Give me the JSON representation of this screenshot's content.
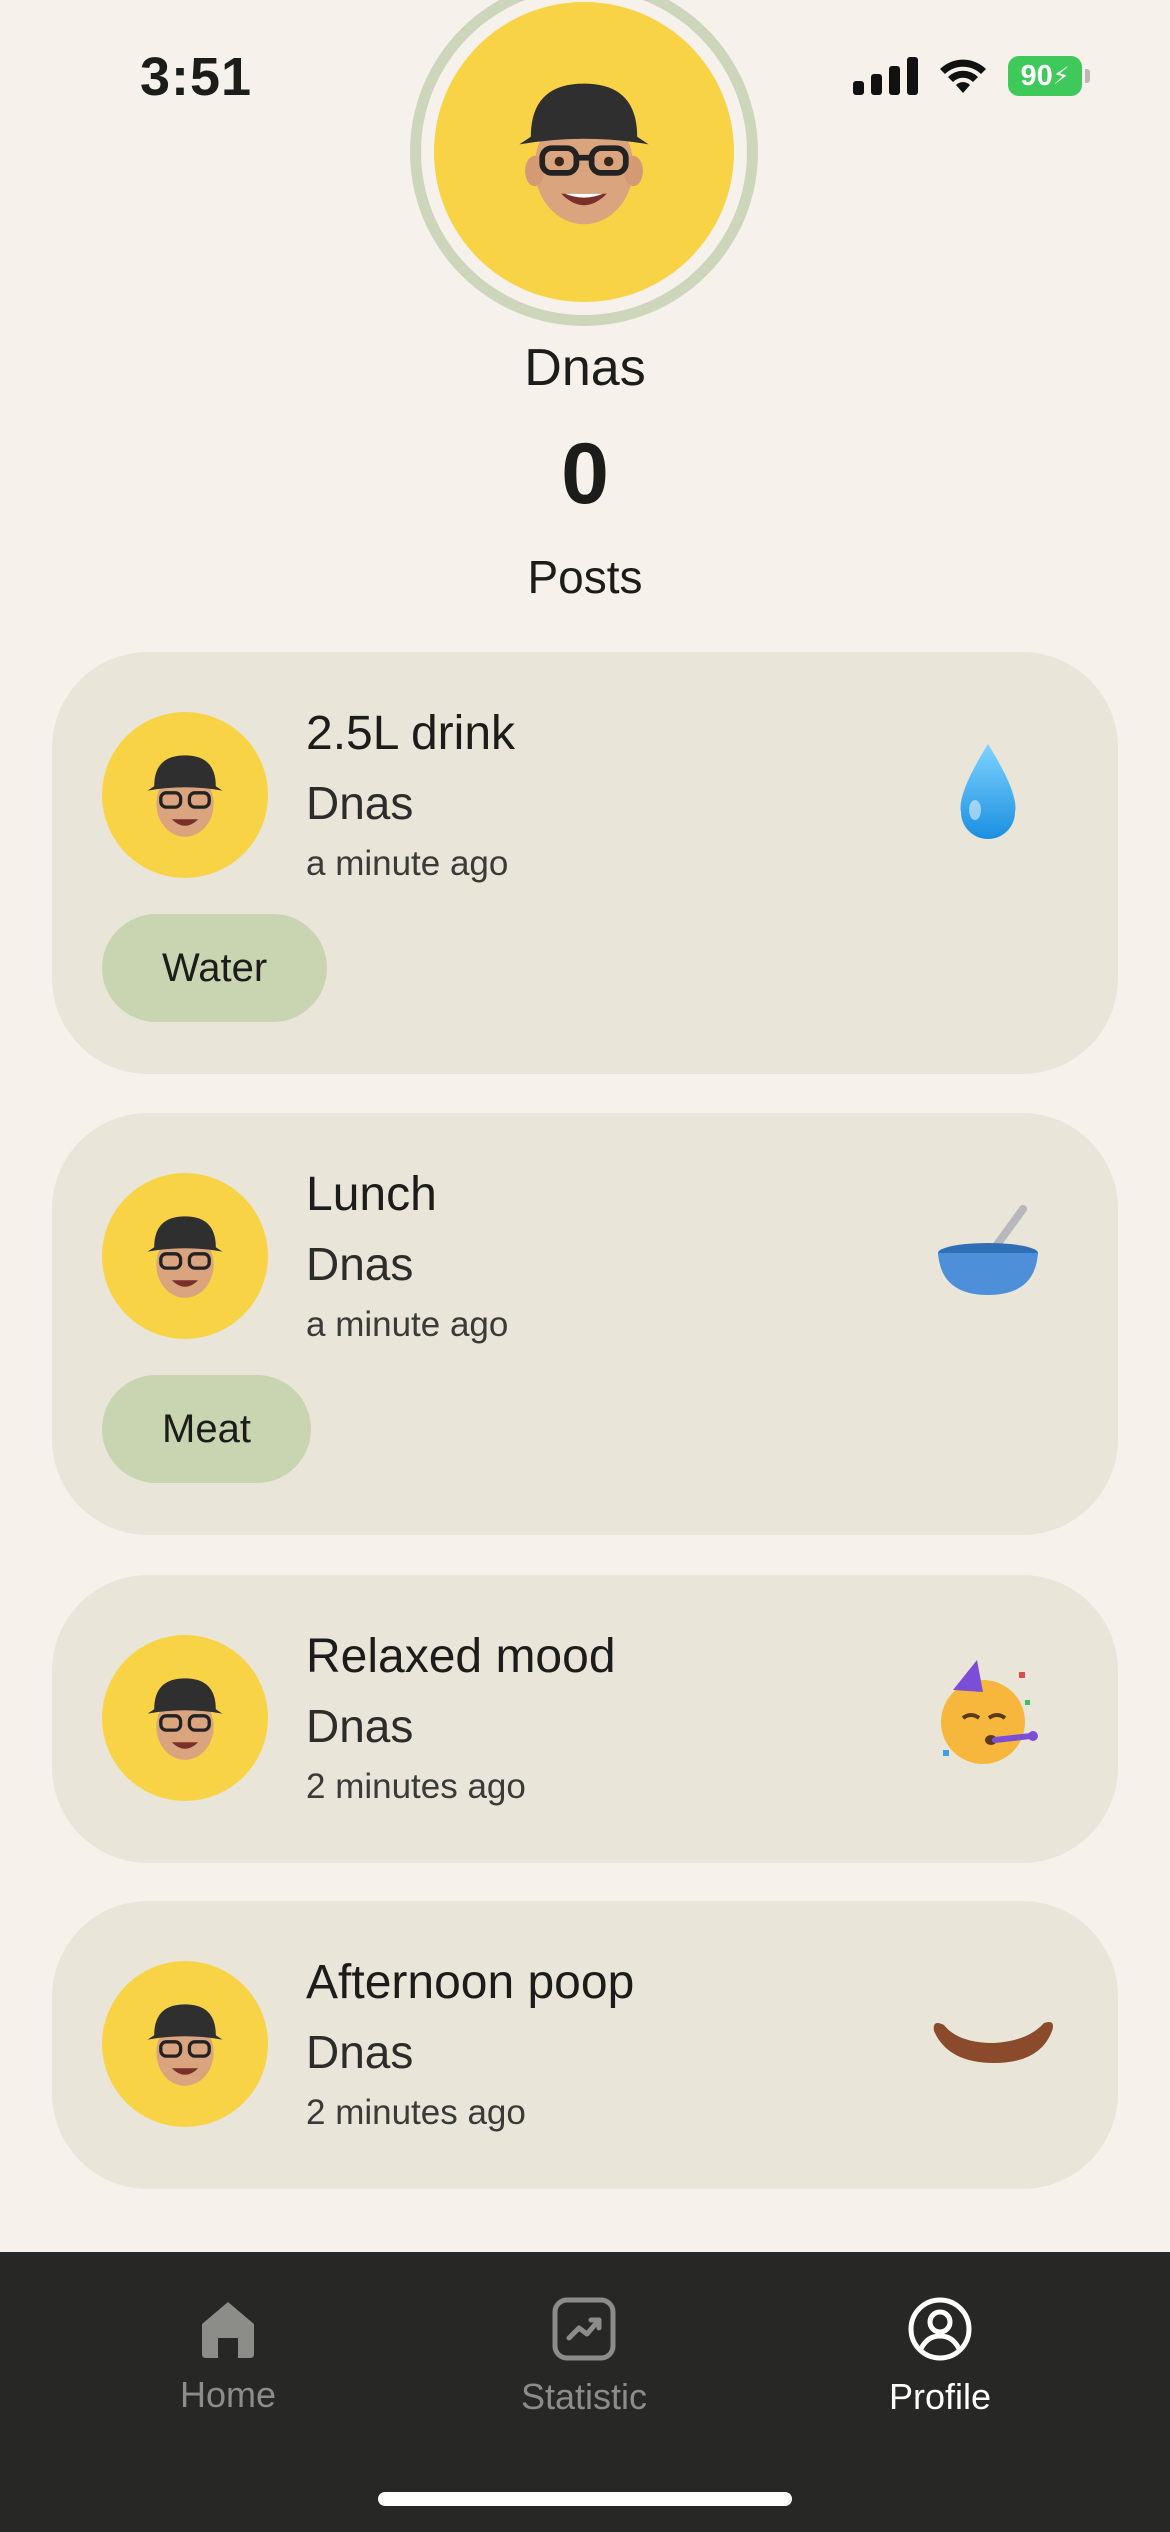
{
  "status_bar": {
    "time": "3:51",
    "battery_level": "90"
  },
  "profile": {
    "name": "Dnas",
    "posts_count": "0",
    "posts_label": "Posts",
    "avatar_color": "#f8d346"
  },
  "posts": [
    {
      "title": "2.5L drink",
      "author": "Dnas",
      "time": "a minute ago",
      "tag": "Water",
      "icon": "water-drop-icon"
    },
    {
      "title": "Lunch",
      "author": "Dnas",
      "time": "a minute ago",
      "tag": "Meat",
      "icon": "bowl-icon"
    },
    {
      "title": "Relaxed mood",
      "author": "Dnas",
      "time": "2 minutes ago",
      "tag": "",
      "icon": "party-face-icon"
    },
    {
      "title": "Afternoon poop",
      "author": "Dnas",
      "time": "2 minutes ago",
      "tag": "",
      "icon": "poop-smile-icon"
    }
  ],
  "nav": {
    "home": "Home",
    "statistic": "Statistic",
    "profile": "Profile",
    "active": "Profile"
  },
  "colors": {
    "background": "#f6f1ea",
    "card": "#e9e5d8",
    "tag": "#c9d4b0",
    "nav_bar": "#272725"
  }
}
